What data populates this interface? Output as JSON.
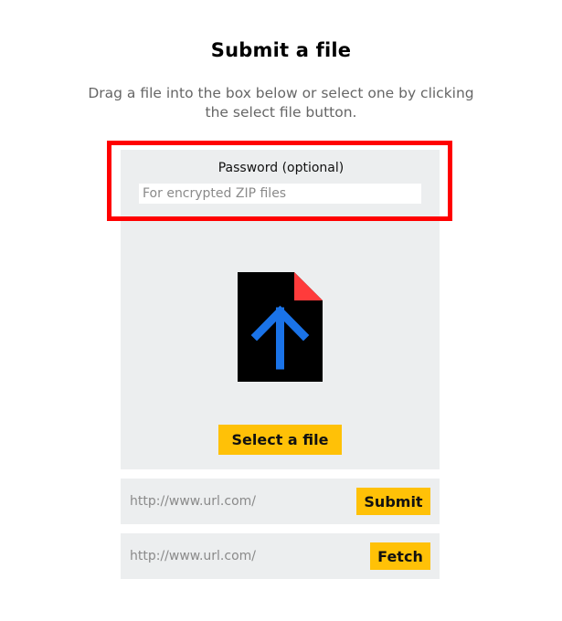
{
  "header": {
    "title": "Submit a file",
    "subtitle": "Drag a file into the box below or select one by clicking the select file button."
  },
  "password": {
    "label": "Password (optional)",
    "placeholder": "For encrypted ZIP files",
    "value": ""
  },
  "dropzone": {
    "icon": "file-upload-icon",
    "select_button_label": "Select a file"
  },
  "url_submit": {
    "placeholder": "http://www.url.com/",
    "value": "",
    "button_label": "Submit"
  },
  "url_fetch": {
    "placeholder": "http://www.url.com/",
    "value": "",
    "button_label": "Fetch"
  },
  "colors": {
    "accent": "#ffc107",
    "highlight_border": "#ff0000",
    "panel_bg": "#eceeef",
    "upload_arrow": "#1a73e8",
    "file_corner": "#ff3b3b"
  }
}
